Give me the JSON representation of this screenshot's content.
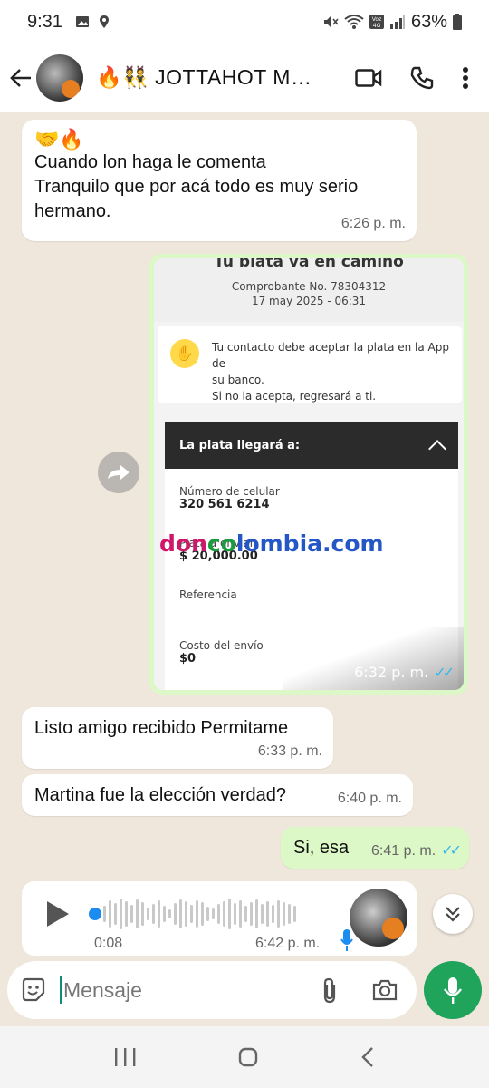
{
  "status_bar": {
    "time": "9:31",
    "battery": "63%"
  },
  "header": {
    "title": "🔥👯 JOTTAHOT MA..."
  },
  "messages": [
    {
      "emojis": "🤝🔥",
      "line1": "Cuando lon haga le comenta",
      "line2": "Tranquilo que por acá todo es muy serio",
      "line3": "hermano.",
      "time": "6:26 p. m."
    },
    {
      "text": "Listo amigo recibido Permitame",
      "time": "6:33 p. m."
    },
    {
      "text": "Martina fue la elección verdad?",
      "time": "6:40 p. m."
    },
    {
      "text": "Si, esa",
      "time": "6:41 p. m."
    }
  ],
  "receipt": {
    "heading_cut": "Tu plata va en camino",
    "comprobante": "Comprobante No. 78304312",
    "date": "17 may 2025 - 06:31",
    "notice_line1": "Tu contacto debe aceptar la plata en la App de",
    "notice_line2": "su banco.",
    "notice_line3": "Si no la acepta, regresará a ti.",
    "section_title": "La plata llegará a:",
    "phone_label": "Número de celular",
    "phone_value": "320 561 6214",
    "amount_label": "Plata a enviar",
    "amount_value": "$ 20,000.00",
    "reference_label": "Referencia",
    "fee_label": "Costo del envío",
    "fee_value": "$0",
    "watermark_a": "don",
    "watermark_b": "co",
    "watermark_c": "lombia.com",
    "time": "6:32 p. m."
  },
  "audio": {
    "duration": "0:08",
    "time": "6:42 p. m."
  },
  "composer": {
    "placeholder": "Mensaje"
  }
}
